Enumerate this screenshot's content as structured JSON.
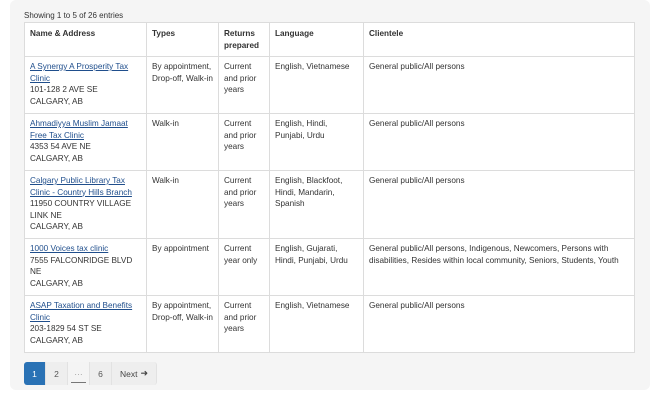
{
  "showing_text": "Showing 1 to 5 of 26 entries",
  "columns": [
    "Name & Address",
    "Types",
    "Returns prepared",
    "Language",
    "Clientele"
  ],
  "rows": [
    {
      "name": "A Synergy A Prosperity Tax Clinic",
      "address": [
        "101-128 2 AVE SE",
        "CALGARY, AB"
      ],
      "types": "By appointment, Drop-off, Walk-in",
      "returns": "Current and prior years",
      "language": "English, Vietnamese",
      "clientele": "General public/All persons"
    },
    {
      "name": "Ahmadiyya Muslim Jamaat Free Tax Clinic",
      "address": [
        "4353 54 AVE NE",
        "CALGARY, AB"
      ],
      "types": "Walk-in",
      "returns": "Current and prior years",
      "language": "English, Hindi, Punjabi, Urdu",
      "clientele": "General public/All persons"
    },
    {
      "name": "Calgary Public Library Tax Clinic - Country Hills Branch",
      "address": [
        "11950 COUNTRY VILLAGE LINK NE",
        "CALGARY, AB"
      ],
      "types": "Walk-in",
      "returns": "Current and prior years",
      "language": "English, Blackfoot, Hindi, Mandarin, Spanish",
      "clientele": "General public/All persons"
    },
    {
      "name": "1000 Voices tax clinic",
      "address": [
        "7555 FALCONRIDGE BLVD NE",
        "CALGARY, AB"
      ],
      "types": "By appointment",
      "returns": "Current year only",
      "language": "English, Gujarati, Hindi, Punjabi, Urdu",
      "clientele": "General public/All persons, Indigenous, Newcomers, Persons with disabilities, Resides within local community, Seniors, Students, Youth"
    },
    {
      "name": "ASAP Taxation and Benefits Clinic",
      "address": [
        "203-1829 54 ST SE",
        "CALGARY, AB"
      ],
      "types": "By appointment, Drop-off, Walk-in",
      "returns": "Current and prior years",
      "language": "English, Vietnamese",
      "clientele": "General public/All persons"
    }
  ],
  "pagination": {
    "pages": [
      "1",
      "2",
      "···",
      "6"
    ],
    "active": "1",
    "next_label": "Next",
    "next_icon": "arrow-right-icon",
    "active_color": "#2a72b5"
  }
}
